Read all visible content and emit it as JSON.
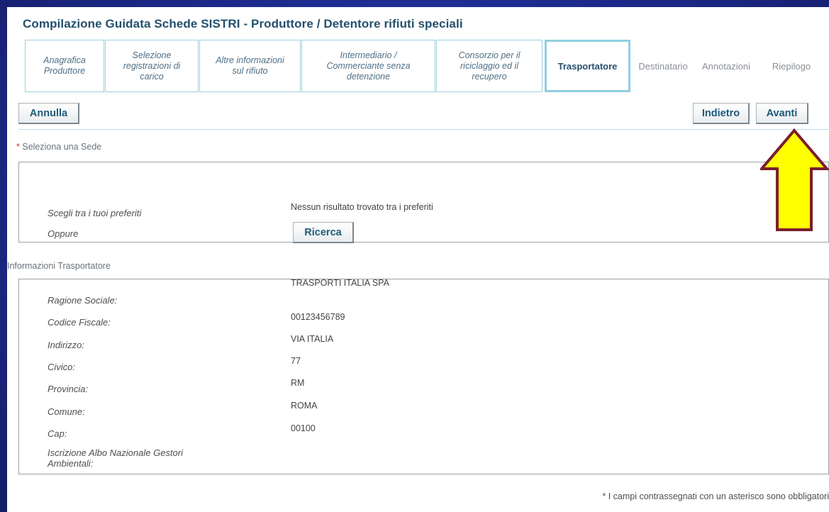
{
  "title": "Compilazione Guidata Schede SISTRI - Produttore / Detentore rifiuti speciali",
  "steps": [
    {
      "label": "Anagrafica Produttore"
    },
    {
      "label": "Selezione registrazioni di carico"
    },
    {
      "label": "Altre informazioni sul rifiuto"
    },
    {
      "label": "Intermediario / Commerciante senza detenzione"
    },
    {
      "label": "Consorzio per il riciclaggio ed il recupero"
    },
    {
      "label": "Trasportatore"
    },
    {
      "label": "Destinatario"
    },
    {
      "label": "Annotazioni"
    },
    {
      "label": "Riepilogo"
    }
  ],
  "toolbar": {
    "annulla": "Annulla",
    "indietro": "Indietro",
    "avanti": "Avanti"
  },
  "sede": {
    "required_mark": "*",
    "label": "Seleziona una Sede",
    "preferiti_label": "Scegli tra i tuoi preferiti",
    "preferiti_value": "Nessun risultato trovato tra i preferiti",
    "oppure_label": "Oppure",
    "ricerca": "Ricerca"
  },
  "trasportatore": {
    "section_label": "Informazioni Trasportatore",
    "fields": [
      {
        "label": "Ragione Sociale:",
        "value": "TRASPORTI ITALIA SPA"
      },
      {
        "label": "Codice Fiscale:",
        "value": "00123456789"
      },
      {
        "label": "Indirizzo:",
        "value": "VIA ITALIA"
      },
      {
        "label": "Civico:",
        "value": "77"
      },
      {
        "label": "Provincia:",
        "value": "RM"
      },
      {
        "label": "Comune:",
        "value": "ROMA"
      },
      {
        "label": "Cap:",
        "value": "00100"
      },
      {
        "label": "Iscrizione Albo Nazionale Gestori Ambientali:",
        "value": ""
      }
    ]
  },
  "footer_note": "* I campi contrassegnati con un asterisco sono obbligatori",
  "arrow_color": "#ffff00",
  "arrow_border_color": "#7a1f2b"
}
